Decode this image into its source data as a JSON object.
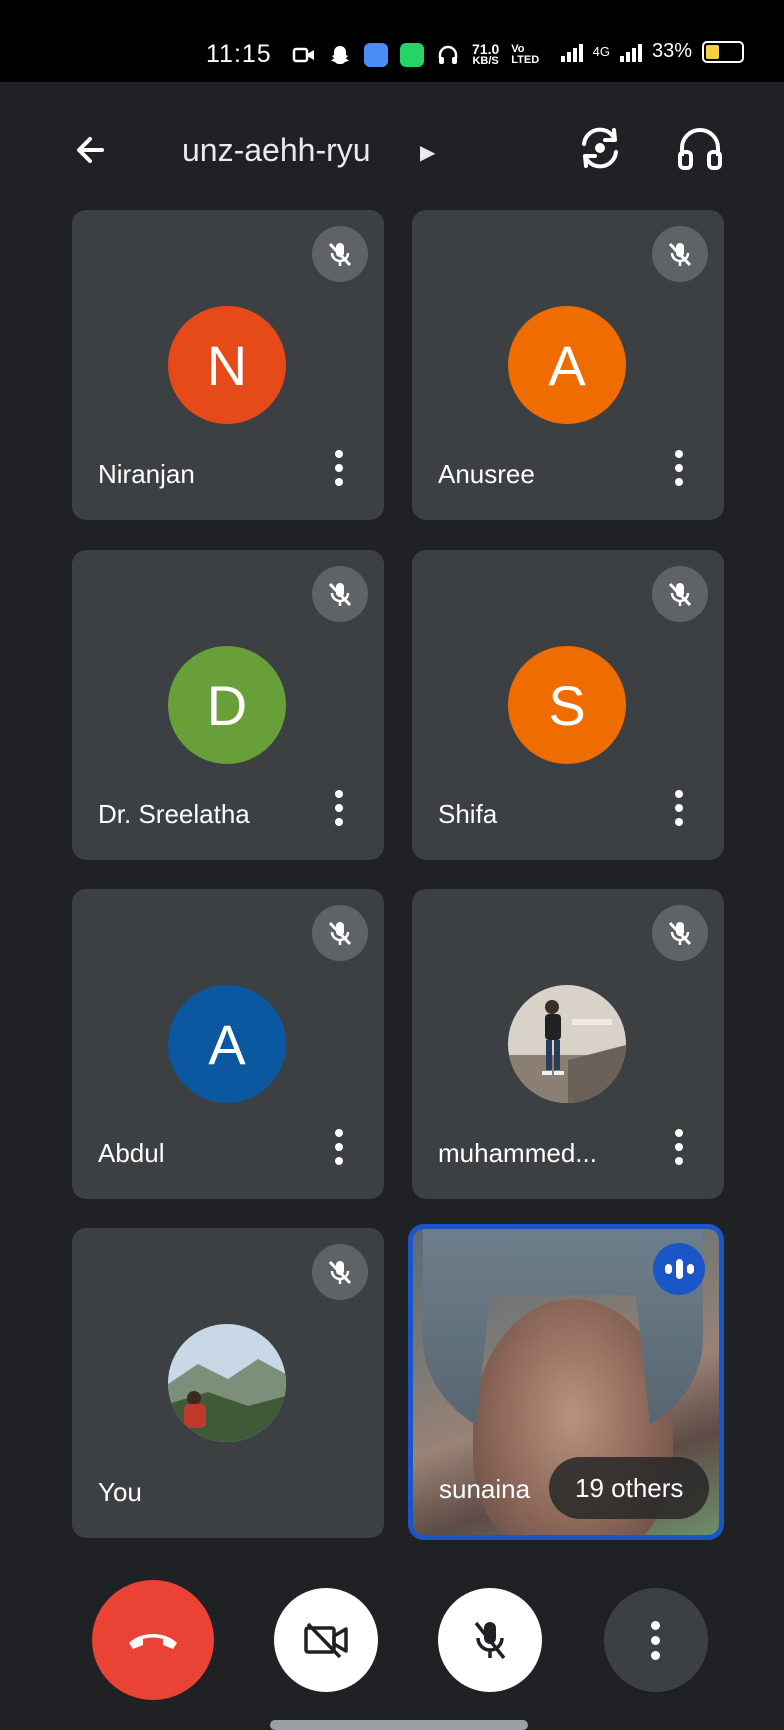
{
  "status_bar": {
    "time": "11:15",
    "net_speed_value": "71.0",
    "net_speed_unit": "KB/S",
    "volte_top": "Vo",
    "volte_bottom": "LTED",
    "network_type": "4G",
    "battery_percent": "33%",
    "battery_level": 0.33,
    "icons": [
      "video-call-icon",
      "snapchat-icon",
      "messenger-icon",
      "phone-app-icon",
      "headset-icon"
    ]
  },
  "header": {
    "meeting_code": "unz-aehh-ryu",
    "icons": [
      "back-arrow-icon",
      "caret-right-icon",
      "switch-camera-icon",
      "headphones-icon"
    ]
  },
  "participants": [
    {
      "name": "Niranjan",
      "initial": "N",
      "color": "#e64a19",
      "muted": true
    },
    {
      "name": "Anusree",
      "initial": "A",
      "color": "#ef6c00",
      "muted": true
    },
    {
      "name": "Dr. Sreelatha",
      "initial": "D",
      "color": "#689f38",
      "muted": true
    },
    {
      "name": "Shifa",
      "initial": "S",
      "color": "#ef6c00",
      "muted": true
    },
    {
      "name": "Abdul",
      "initial": "A",
      "color": "#0b57a0",
      "muted": true
    },
    {
      "name": "muhammed...",
      "initial": "",
      "color": "#c9c1b6",
      "muted": true
    },
    {
      "name": "You",
      "initial": "",
      "color": "#8fb3cf",
      "muted": true
    }
  ],
  "active_speaker": {
    "name": "sunaina",
    "others_label": "19 others",
    "accent": "#1a56c8"
  },
  "controls": {
    "icons": [
      "end-call-icon",
      "camera-off-icon",
      "mic-off-icon",
      "more-options-icon"
    ],
    "end_call_color": "#ea4335"
  }
}
